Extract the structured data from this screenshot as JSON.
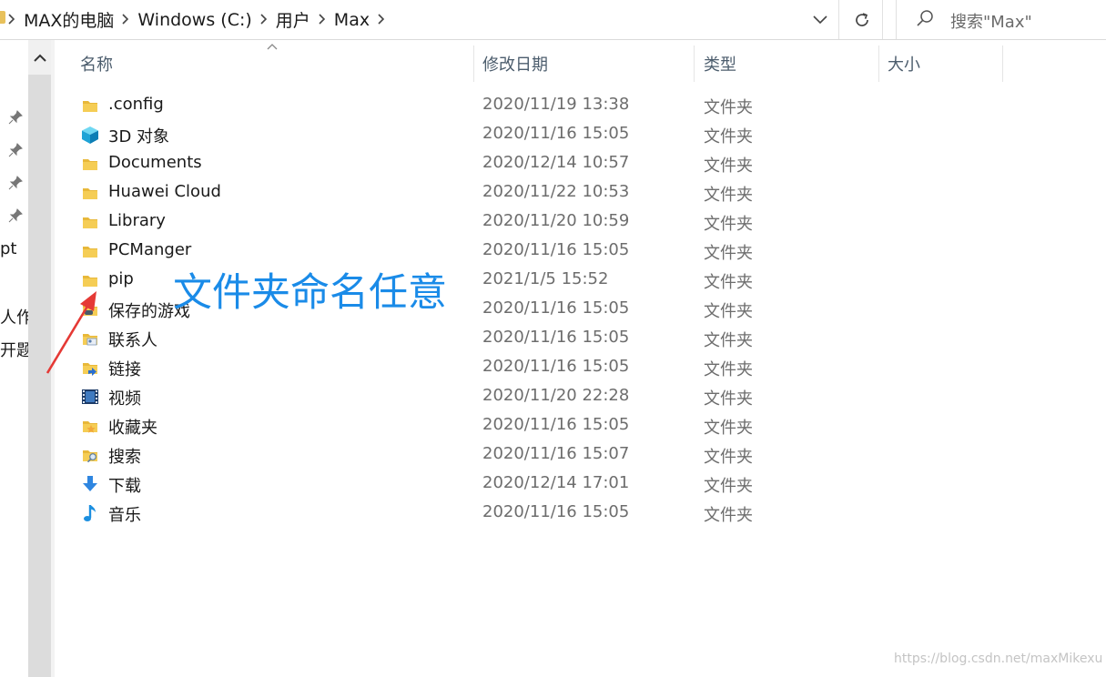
{
  "address_bar": {
    "crumbs": [
      "MAX的电脑",
      "Windows (C:)",
      "用户",
      "Max"
    ]
  },
  "search": {
    "placeholder": "搜索\"Max\""
  },
  "nav_pane": {
    "partial_labels": [
      "pt",
      "人作",
      "开题"
    ]
  },
  "columns": {
    "name": "名称",
    "date_modified": "修改日期",
    "type": "类型",
    "size": "大小"
  },
  "files": [
    {
      "name": ".config",
      "date": "2020/11/19 13:38",
      "type": "文件夹",
      "icon": "folder-icon"
    },
    {
      "name": "3D 对象",
      "date": "2020/11/16 15:05",
      "type": "文件夹",
      "icon": "3d-objects-icon"
    },
    {
      "name": "Documents",
      "date": "2020/12/14 10:57",
      "type": "文件夹",
      "icon": "folder-icon"
    },
    {
      "name": "Huawei Cloud",
      "date": "2020/11/22 10:53",
      "type": "文件夹",
      "icon": "folder-icon"
    },
    {
      "name": "Library",
      "date": "2020/11/20 10:59",
      "type": "文件夹",
      "icon": "folder-icon"
    },
    {
      "name": "PCManger",
      "date": "2020/11/16 15:05",
      "type": "文件夹",
      "icon": "folder-icon"
    },
    {
      "name": "pip",
      "date": "2021/1/5 15:52",
      "type": "文件夹",
      "icon": "folder-icon"
    },
    {
      "name": "保存的游戏",
      "date": "2020/11/16 15:05",
      "type": "文件夹",
      "icon": "saved-games-icon"
    },
    {
      "name": "联系人",
      "date": "2020/11/16 15:05",
      "type": "文件夹",
      "icon": "contacts-icon"
    },
    {
      "name": "链接",
      "date": "2020/11/16 15:05",
      "type": "文件夹",
      "icon": "links-icon"
    },
    {
      "name": "视频",
      "date": "2020/11/20 22:28",
      "type": "文件夹",
      "icon": "videos-icon"
    },
    {
      "name": "收藏夹",
      "date": "2020/11/16 15:05",
      "type": "文件夹",
      "icon": "favorites-icon"
    },
    {
      "name": "搜索",
      "date": "2020/11/16 15:07",
      "type": "文件夹",
      "icon": "searches-icon"
    },
    {
      "name": "下载",
      "date": "2020/12/14 17:01",
      "type": "文件夹",
      "icon": "downloads-icon"
    },
    {
      "name": "音乐",
      "date": "2020/11/16 15:05",
      "type": "文件夹",
      "icon": "music-icon"
    }
  ],
  "annotation": {
    "text": "文件夹命名任意",
    "color": "#1a8be8"
  },
  "watermark": "https://blog.csdn.net/maxMikexu",
  "colors": {
    "folder": "#f0c24a",
    "arrow": "#e53935",
    "accent": "#1a8be8"
  }
}
